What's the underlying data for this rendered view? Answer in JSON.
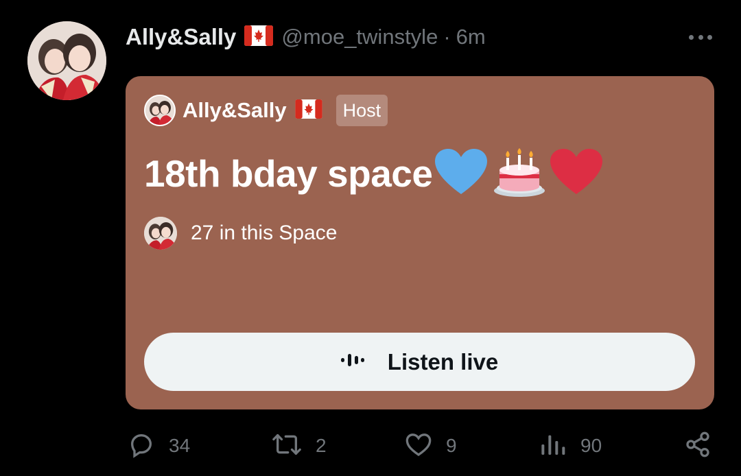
{
  "tweet": {
    "display_name": "Ally&Sally",
    "handle": "@moe_twinstyle",
    "separator": "·",
    "time": "6m",
    "more_icon": "more-horizontal-icon"
  },
  "space_card": {
    "background": "#9b6350",
    "host_name": "Ally&Sally",
    "host_badge": "Host",
    "title": "18th bday space",
    "title_emojis": [
      "blue-heart",
      "birthday-cake",
      "red-heart"
    ],
    "listeners_text": "27 in this Space",
    "listen_button_label": "Listen live"
  },
  "actions": {
    "reply_count": "34",
    "retweet_count": "2",
    "like_count": "9",
    "views_count": "90"
  },
  "colors": {
    "background": "#000000",
    "text_primary": "#e7e9ea",
    "text_secondary": "#71767b",
    "button_bg": "#eff3f4",
    "button_text": "#0f1419"
  }
}
